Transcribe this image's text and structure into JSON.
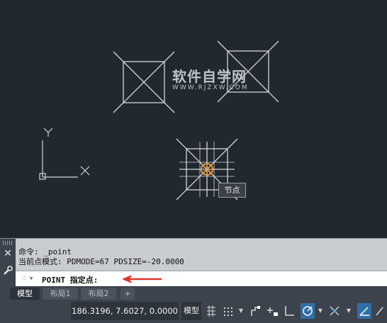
{
  "watermark": {
    "title": "软件自学网",
    "url": "WWW.RJZXW.COM"
  },
  "canvas": {
    "tooltip": "节点",
    "ucs": {
      "x_label": "X",
      "y_label": "Y"
    }
  },
  "command_panel": {
    "history": [
      "命令: _point",
      "当前点模式:  PDMODE=67  PDSIZE=-20.0000"
    ],
    "prompt": "POINT 指定点:",
    "close_label": "✕"
  },
  "tabs": {
    "items": [
      "模型",
      "布局1",
      "布局2"
    ],
    "active": 0,
    "add_label": "+"
  },
  "status_bar": {
    "coordinates": "186.3196, 7.6027, 0.0000",
    "model_label": "模型",
    "buttons": [
      "grid-icon",
      "snap-icon",
      "infer-icon",
      "dynamic-input-icon",
      "ortho-icon",
      "polar-icon",
      "osnap-track-icon",
      "osnap-icon"
    ]
  },
  "colors": {
    "canvas_bg": "#212830",
    "geometry": "#d6d6d6",
    "snap_marker": "#e89a3c",
    "arrow": "#e0362c",
    "status_active": "#2f6fa8"
  }
}
